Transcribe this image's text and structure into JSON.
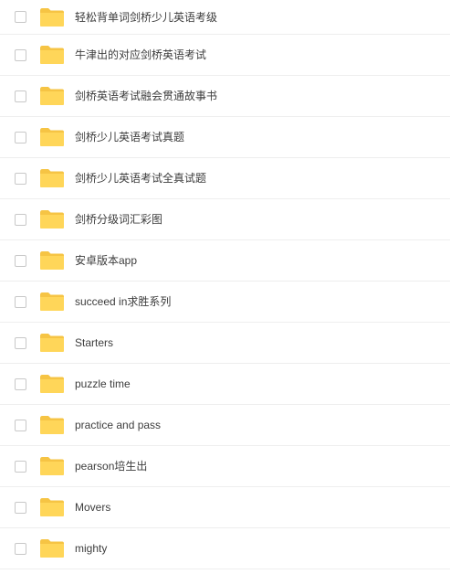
{
  "colors": {
    "folder_fill": "#FFD659",
    "folder_tab": "#F6C444",
    "text": "#3d3d3d",
    "divider": "#eeeeee",
    "checkbox_border": "#c8c8c8"
  },
  "files": [
    {
      "name": "轻松背单词剑桥少儿英语考级",
      "icon": "folder-icon"
    },
    {
      "name": "牛津出的对应剑桥英语考试",
      "icon": "folder-icon"
    },
    {
      "name": "剑桥英语考试融会贯通故事书",
      "icon": "folder-icon"
    },
    {
      "name": "剑桥少儿英语考试真题",
      "icon": "folder-icon"
    },
    {
      "name": "剑桥少儿英语考试全真试题",
      "icon": "folder-icon"
    },
    {
      "name": "剑桥分级词汇彩图",
      "icon": "folder-icon"
    },
    {
      "name": "安卓版本app",
      "icon": "folder-icon"
    },
    {
      "name": "succeed in求胜系列",
      "icon": "folder-icon"
    },
    {
      "name": "Starters",
      "icon": "folder-icon"
    },
    {
      "name": "puzzle time",
      "icon": "folder-icon"
    },
    {
      "name": "practice and pass",
      "icon": "folder-icon"
    },
    {
      "name": "pearson培生出",
      "icon": "folder-icon"
    },
    {
      "name": "Movers",
      "icon": "folder-icon"
    },
    {
      "name": "mighty",
      "icon": "folder-icon"
    }
  ]
}
